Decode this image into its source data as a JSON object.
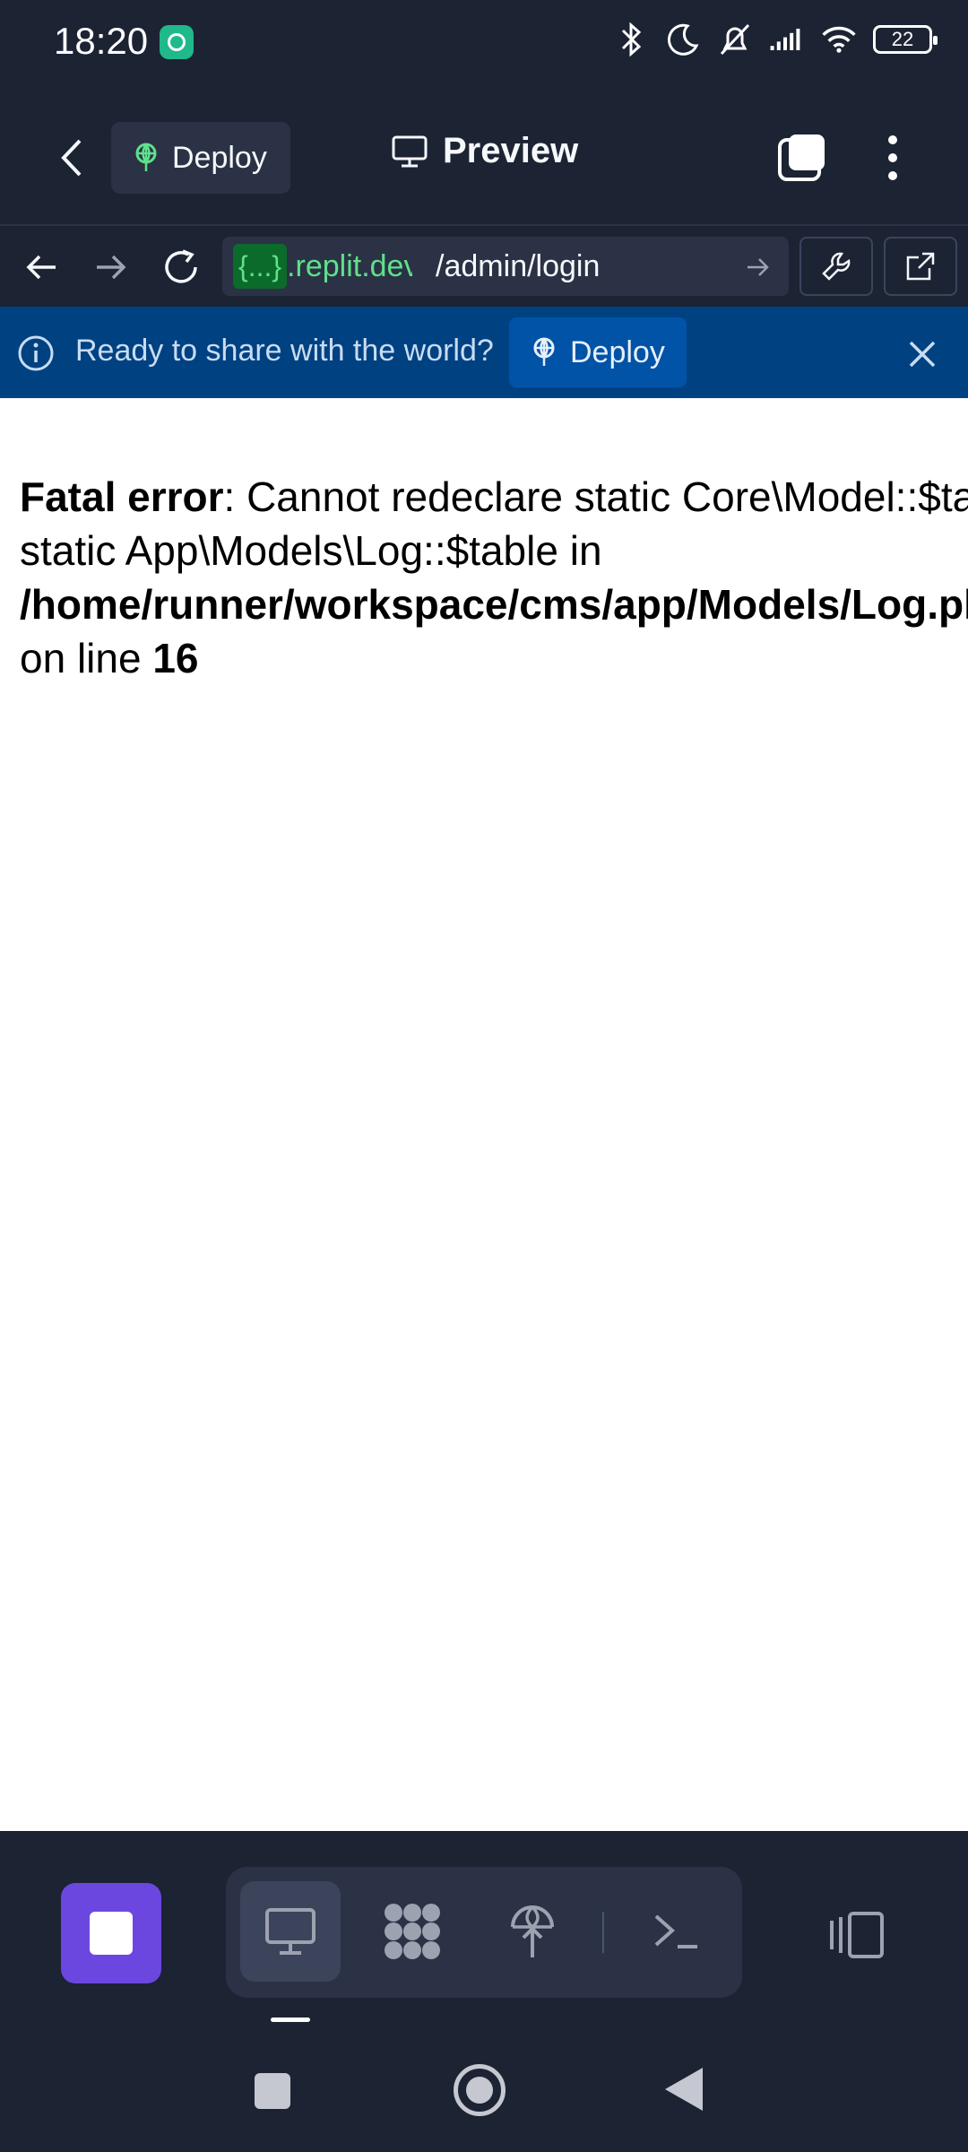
{
  "status_bar": {
    "time": "18:20",
    "battery_level": "22",
    "icons": [
      "replit-app-icon",
      "bluetooth-icon",
      "moon-icon",
      "bell-off-icon",
      "signal-icon",
      "wifi-icon",
      "battery-icon"
    ]
  },
  "header": {
    "deploy_label": "Deploy",
    "title": "Preview"
  },
  "address_bar": {
    "host_prefix": "{...}",
    "host": ".replit.dev",
    "path": "/admin/login"
  },
  "banner": {
    "message": "Ready to share with the world?",
    "deploy_label": "Deploy",
    "bg_color": "#004182"
  },
  "page": {
    "error_label": "Fatal error",
    "error_message": ": Cannot redeclare static Core\\Model::$table as non static App\\Models\\Log::$table in ",
    "file_path": "/home/runner/workspace/cms/app/Models/Log.php",
    "line_prefix": " on line ",
    "line_number": "16"
  },
  "bottom_toolbar": {
    "stop_color": "#6b47e0",
    "tools": [
      "preview-icon",
      "apps-icon",
      "deploy-icon",
      "shell-icon"
    ]
  }
}
